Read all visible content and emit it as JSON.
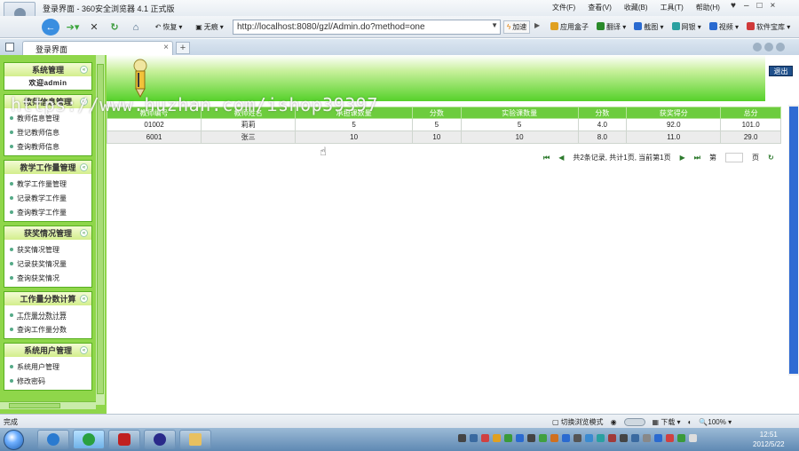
{
  "browser": {
    "window_title": "登录界面 - 360安全浏览器 4.1 正式版",
    "menu": [
      "文件(F)",
      "查看(V)",
      "收藏(B)",
      "工具(T)",
      "帮助(H)"
    ],
    "restore_label": "恢复",
    "noimg_label": "无痕",
    "address_url": "http://localhost:8080/gzl/Admin.do?method=one",
    "speed_label": "加速",
    "extras": [
      {
        "label": "应用盒子",
        "color": "#e0a020"
      },
      {
        "label": "翻译",
        "color": "#2a8a2a"
      },
      {
        "label": "截图",
        "color": "#2a6ad0"
      },
      {
        "label": "网银",
        "color": "#2aa0a0"
      },
      {
        "label": "视频",
        "color": "#2a6ad0"
      },
      {
        "label": "软件宝库",
        "color": "#d03a3a"
      }
    ],
    "tab_title": "登录界面",
    "new_tab": "+",
    "status_text": "完成",
    "switch_mode": "切换浏览模式",
    "download_label": "下载",
    "zoom": "100%"
  },
  "watermark": "https://www.huzhan.com/ishop39397",
  "sidebar": {
    "sections": [
      {
        "title": "系统管理",
        "welcome": "欢迎admin",
        "items": []
      },
      {
        "title": "教师信息管理",
        "items": [
          "教师信息管理",
          "登记教师信息",
          "查询教师信息"
        ]
      },
      {
        "title": "教学工作量管理",
        "items": [
          "教学工作量管理",
          "记录教学工作量",
          "查询教学工作量"
        ]
      },
      {
        "title": "获奖情况管理",
        "items": [
          "获奖情况管理",
          "记录获奖情况量",
          "查询获奖情况"
        ]
      },
      {
        "title": "工作量分数计算",
        "items": [
          "工作量分数计算",
          "查询工作量分数"
        ]
      },
      {
        "title": "系统用户管理",
        "items": [
          "系统用户管理",
          "修改密码"
        ]
      }
    ]
  },
  "header": {
    "exit_label": "退出"
  },
  "table": {
    "columns": [
      "教师编号",
      "教师姓名",
      "承担课数量",
      "分数",
      "实验课数量",
      "分数",
      "获奖得分",
      "总分"
    ],
    "rows": [
      [
        "01002",
        "莉莉",
        "5",
        "5",
        "5",
        "4.0",
        "92.0",
        "101.0"
      ],
      [
        "6001",
        "张三",
        "10",
        "10",
        "10",
        "8.0",
        "11.0",
        "29.0"
      ]
    ]
  },
  "pager": {
    "summary": "共2条记录, 共计1页, 当前第1页",
    "jump_prefix": "第",
    "jump_suffix": "页"
  },
  "taskbar": {
    "clock_time": "12:51",
    "clock_date": "2012/5/22"
  }
}
